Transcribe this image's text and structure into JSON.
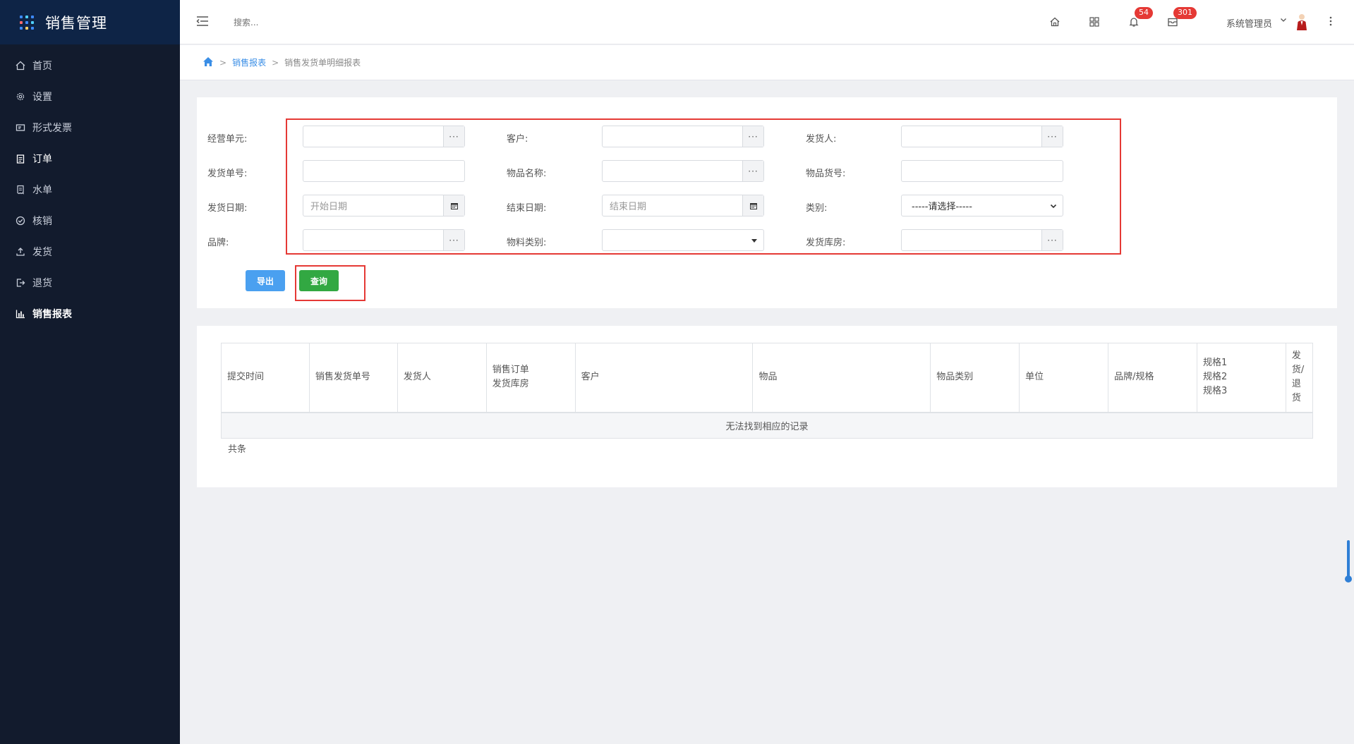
{
  "sidebar": {
    "brand_title": "销售管理",
    "items": [
      {
        "label": "首页",
        "icon": "home-icon"
      },
      {
        "label": "设置",
        "icon": "gear-icon"
      },
      {
        "label": "形式发票",
        "icon": "invoice-icon"
      },
      {
        "label": "订单",
        "icon": "clipboard-icon"
      },
      {
        "label": "水单",
        "icon": "receipt-icon"
      },
      {
        "label": "核销",
        "icon": "check-circle-icon"
      },
      {
        "label": "发货",
        "icon": "upload-icon"
      },
      {
        "label": "退货",
        "icon": "return-icon"
      },
      {
        "label": "销售报表",
        "icon": "bar-chart-icon"
      }
    ]
  },
  "header": {
    "search_placeholder": "搜索...",
    "notifications_count": "54",
    "messages_count": "301",
    "user_name": "系统管理员"
  },
  "breadcrumb": {
    "level1": "销售报表",
    "level2": "销售发货单明细报表"
  },
  "filters": {
    "business_unit_label": "经营单元:",
    "customer_label": "客户:",
    "shipper_label": "发货人:",
    "ship_no_label": "发货单号:",
    "item_name_label": "物品名称:",
    "item_code_label": "物品货号:",
    "ship_date_label": "发货日期:",
    "start_date_placeholder": "开始日期",
    "end_date_label": "结束日期:",
    "end_date_placeholder": "结束日期",
    "category_label": "类别:",
    "category_selected": "-----请选择-----",
    "brand_label": "品牌:",
    "material_category_label": "物料类别:",
    "warehouse_label": "发货库房:",
    "addon_text": "···"
  },
  "buttons": {
    "export": "导出",
    "query": "查询"
  },
  "table": {
    "headers": {
      "submit_time": "提交时间",
      "ship_no": "销售发货单号",
      "shipper": "发货人",
      "order_line1": "销售订单",
      "order_line2": "发货库房",
      "customer": "客户",
      "item": "物品",
      "item_category": "物品类别",
      "unit": "单位",
      "brand_spec": "品牌/规格",
      "spec1": "规格1",
      "spec2": "规格2",
      "spec3": "规格3",
      "ship_return": "发货/退货"
    },
    "empty_message": "无法找到相应的记录",
    "total_text": "共条"
  },
  "colors": {
    "sidebar_bg": "#121b2d",
    "brand_bg": "#0e2446",
    "highlight_border": "#e53935",
    "export_btn": "#4aa0f0",
    "query_btn": "#32a842",
    "link": "#3a8ee6"
  }
}
